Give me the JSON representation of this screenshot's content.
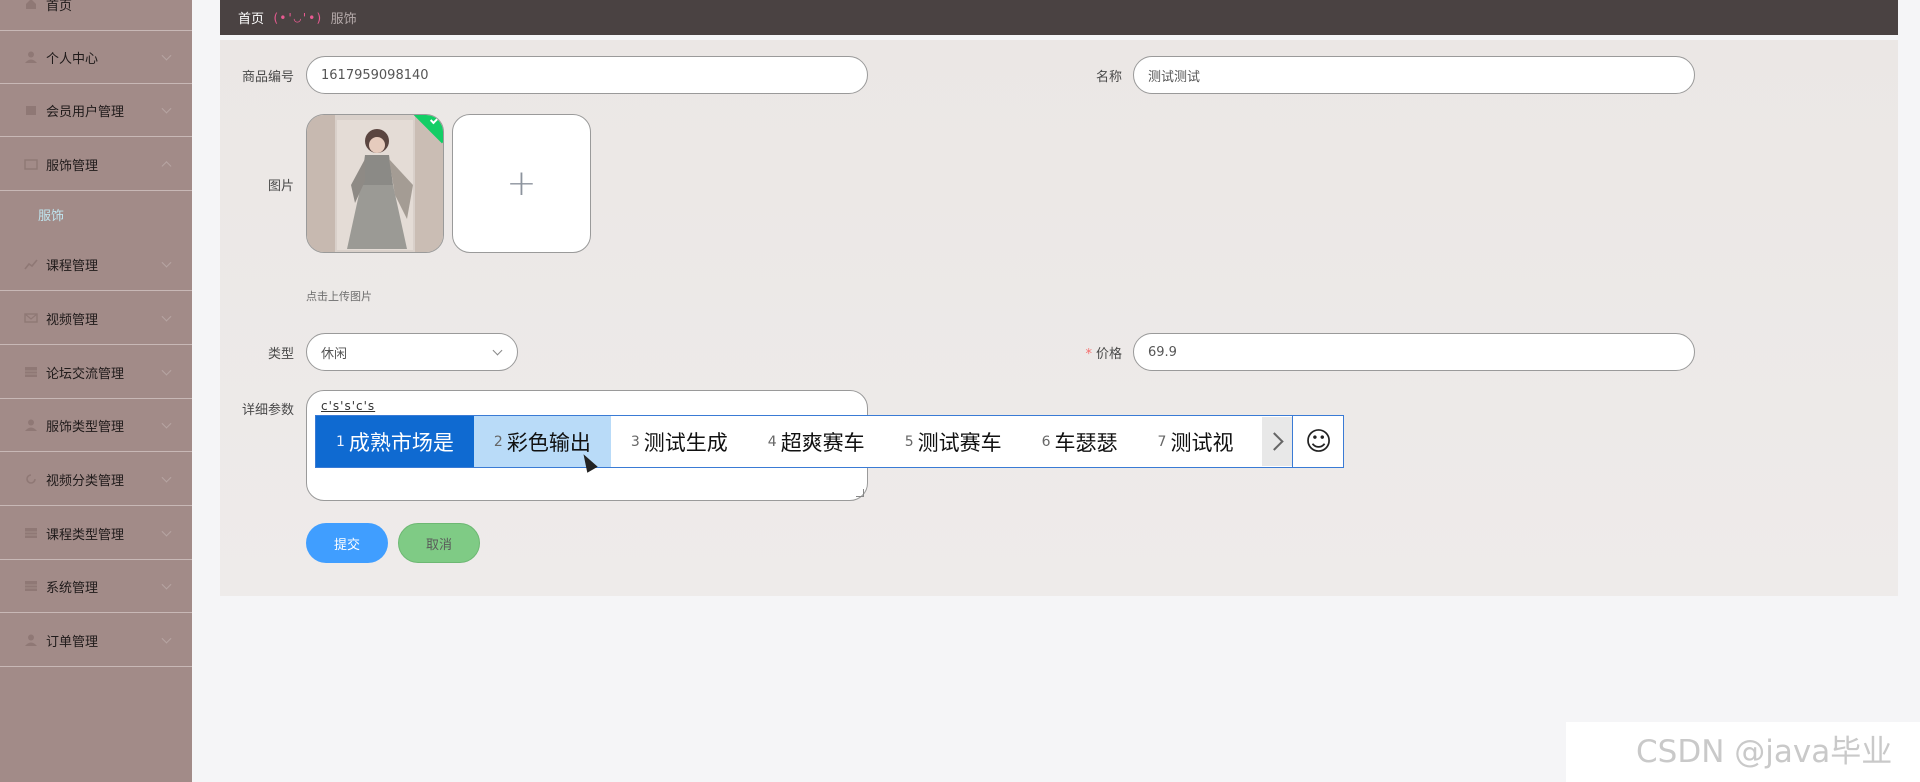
{
  "sidebar": {
    "items": [
      {
        "label": "首页",
        "icon": "home-icon"
      },
      {
        "label": "个人中心",
        "icon": "user-icon"
      },
      {
        "label": "会员用户管理",
        "icon": "users-icon"
      },
      {
        "label": "服饰管理",
        "icon": "folder-icon"
      },
      {
        "label": "课程管理",
        "icon": "chart-icon"
      },
      {
        "label": "视频管理",
        "icon": "mail-icon"
      },
      {
        "label": "论坛交流管理",
        "icon": "table-icon"
      },
      {
        "label": "服饰类型管理",
        "icon": "user-icon"
      },
      {
        "label": "视频分类管理",
        "icon": "refresh-icon"
      },
      {
        "label": "课程类型管理",
        "icon": "table-icon"
      },
      {
        "label": "系统管理",
        "icon": "table-icon"
      },
      {
        "label": "订单管理",
        "icon": "user-icon"
      }
    ],
    "active_sub": "服饰"
  },
  "breadcrumb": {
    "home": "首页",
    "face": "(•'◡'•)",
    "current": "服饰"
  },
  "form": {
    "code_label": "商品编号",
    "code_value": "1617959098140",
    "name_label": "名称",
    "name_value": "测试测试",
    "image_label": "图片",
    "upload_plus": "+",
    "upload_hint": "点击上传图片",
    "type_label": "类型",
    "type_value": "休闲",
    "price_required": "*",
    "price_label": "价格",
    "price_value": "69.9",
    "detail_label": "详细参数",
    "detail_value": "c's's'c's",
    "submit_label": "提交",
    "cancel_label": "取消"
  },
  "ime": {
    "candidates": [
      {
        "num": "1",
        "text": "成熟市场是"
      },
      {
        "num": "2",
        "text": "彩色输出"
      },
      {
        "num": "3",
        "text": "测试生成"
      },
      {
        "num": "4",
        "text": "超爽赛车"
      },
      {
        "num": "5",
        "text": "测试赛车"
      },
      {
        "num": "6",
        "text": "车瑟瑟"
      },
      {
        "num": "7",
        "text": "测试视"
      }
    ],
    "emoji": "☺"
  },
  "watermark": "CSDN @java毕业",
  "colors": {
    "sidebar_bg": "#a28b88",
    "topbar_bg": "#4a4242",
    "primary": "#409eff",
    "cancel": "#7fcb85",
    "ime_selected": "#0f6ad1",
    "success": "#13ce66"
  }
}
